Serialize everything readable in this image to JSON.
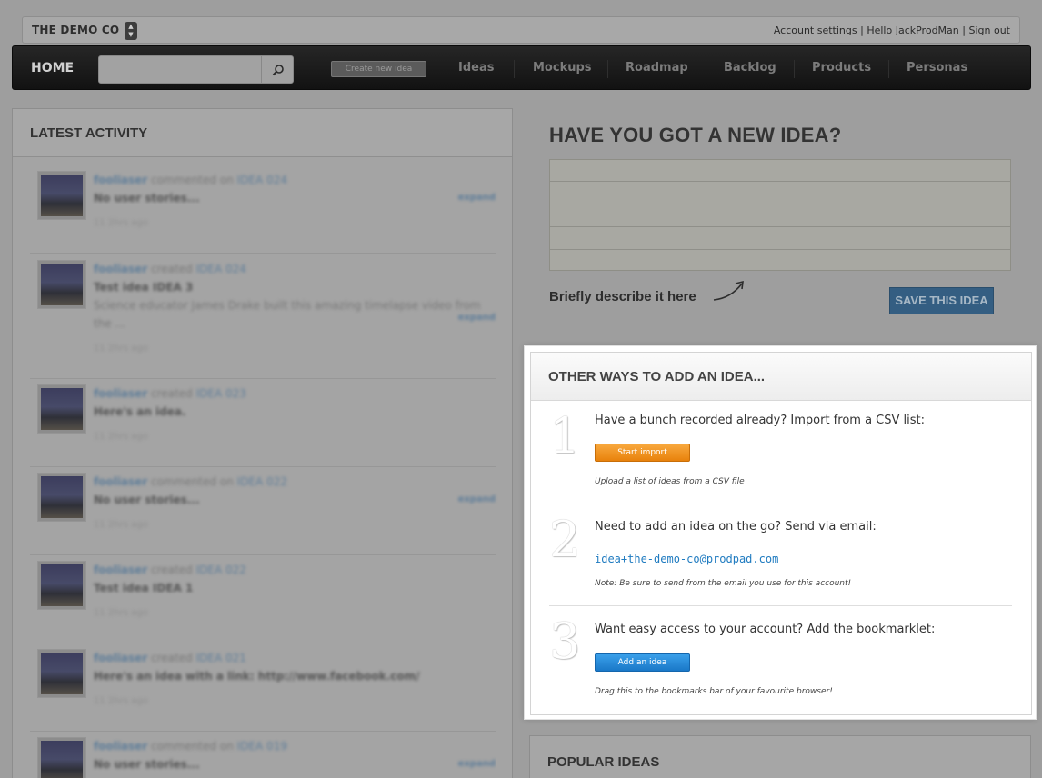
{
  "topbar": {
    "company": "THE DEMO CO",
    "account_settings": "Account settings",
    "sep1": "|",
    "hello": "Hello",
    "username": "JackProdMan",
    "sep2": "|",
    "sign_out": "Sign out"
  },
  "nav": {
    "home": "HOME",
    "search_placeholder": "",
    "create": "Create new idea",
    "links": [
      "Ideas",
      "Mockups",
      "Roadmap",
      "Backlog",
      "Products",
      "Personas"
    ]
  },
  "activity": {
    "title": "LATEST ACTIVITY",
    "items": [
      {
        "user": "fooliaser",
        "action": "commented on",
        "idea": "IDEA 024",
        "body": "No user stories...",
        "desc": "",
        "time": "11 2hrs ago",
        "expand": "expand"
      },
      {
        "user": "fooliaser",
        "action": "created",
        "idea": "IDEA 024",
        "body": "Test idea IDEA 3",
        "desc": "Science educator James Drake built this amazing timelapse video from the ...",
        "time": "11 2hrs ago",
        "expand": "expand"
      },
      {
        "user": "fooliaser",
        "action": "created",
        "idea": "IDEA 023",
        "body": "Here's an idea.",
        "desc": "",
        "time": "11 2hrs ago",
        "expand": ""
      },
      {
        "user": "fooliaser",
        "action": "commented on",
        "idea": "IDEA 022",
        "body": "No user stories...",
        "desc": "",
        "time": "11 2hrs ago",
        "expand": "expand"
      },
      {
        "user": "fooliaser",
        "action": "created",
        "idea": "IDEA 022",
        "body": "Test idea IDEA 1",
        "desc": "",
        "time": "11 2hrs ago",
        "expand": ""
      },
      {
        "user": "fooliaser",
        "action": "created",
        "idea": "IDEA 021",
        "body": "Here's an idea with a link: http://www.facebook.com/",
        "desc": "",
        "time": "11 2hrs ago",
        "expand": ""
      },
      {
        "user": "fooliaser",
        "action": "commented on",
        "idea": "IDEA 019",
        "body": "No user stories...",
        "desc": "",
        "time": "",
        "expand": "expand"
      }
    ]
  },
  "new_idea": {
    "heading": "HAVE YOU GOT A NEW IDEA?",
    "hint": "Briefly describe it here",
    "save": "SAVE THIS IDEA"
  },
  "other_ways": {
    "title": "OTHER WAYS TO ADD AN IDEA...",
    "steps": [
      {
        "num": "1",
        "title": "Have a bunch recorded already? Import from a CSV list:",
        "button": "Start import",
        "note": "Upload a list of ideas from a CSV file"
      },
      {
        "num": "2",
        "title": "Need to add an idea on the go? Send via email:",
        "email": "idea+the-demo-co@prodpad.com",
        "note": "Note: Be sure to send from the email you use for this account!"
      },
      {
        "num": "3",
        "title": "Want easy access to your account? Add the bookmarklet:",
        "button": "Add an idea",
        "note": "Drag this to the bookmarks bar of your favourite browser!"
      }
    ]
  },
  "popular": {
    "title": "POPULAR IDEAS"
  }
}
